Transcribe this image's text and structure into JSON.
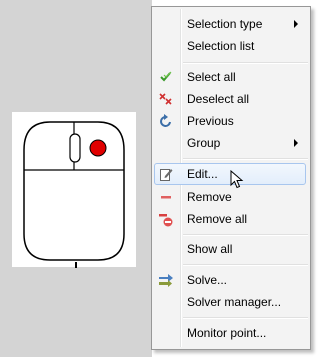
{
  "menu": {
    "items": [
      {
        "id": "selection-type",
        "label": "Selection type",
        "icon": "",
        "submenu": true
      },
      {
        "id": "selection-list",
        "label": "Selection list",
        "icon": "",
        "submenu": false
      },
      {
        "id": "select-all",
        "label": "Select all",
        "icon": "green-check-icon",
        "submenu": false
      },
      {
        "id": "deselect-all",
        "label": "Deselect all",
        "icon": "red-x-icon",
        "submenu": false
      },
      {
        "id": "previous",
        "label": "Previous",
        "icon": "undo-arrow-icon",
        "submenu": false
      },
      {
        "id": "group",
        "label": "Group",
        "icon": "",
        "submenu": true
      },
      {
        "id": "edit",
        "label": "Edit...",
        "icon": "pencil-edit-icon",
        "submenu": false,
        "highlighted": true
      },
      {
        "id": "remove",
        "label": "Remove",
        "icon": "minus-icon",
        "submenu": false
      },
      {
        "id": "remove-all",
        "label": "Remove all",
        "icon": "double-minus-icon",
        "submenu": false
      },
      {
        "id": "show-all",
        "label": "Show all",
        "icon": "",
        "submenu": false
      },
      {
        "id": "solve",
        "label": "Solve...",
        "icon": "solve-arrows-icon",
        "submenu": false
      },
      {
        "id": "solver-manager",
        "label": "Solver manager...",
        "icon": "",
        "submenu": false
      },
      {
        "id": "monitor-point",
        "label": "Monitor point...",
        "icon": "",
        "submenu": false
      }
    ]
  },
  "colors": {
    "menu_bg": "#f3f3f3",
    "highlight_border": "#a8c6ee",
    "canvas_bg": "#d4d4d4",
    "red_dot": "#e00000"
  }
}
